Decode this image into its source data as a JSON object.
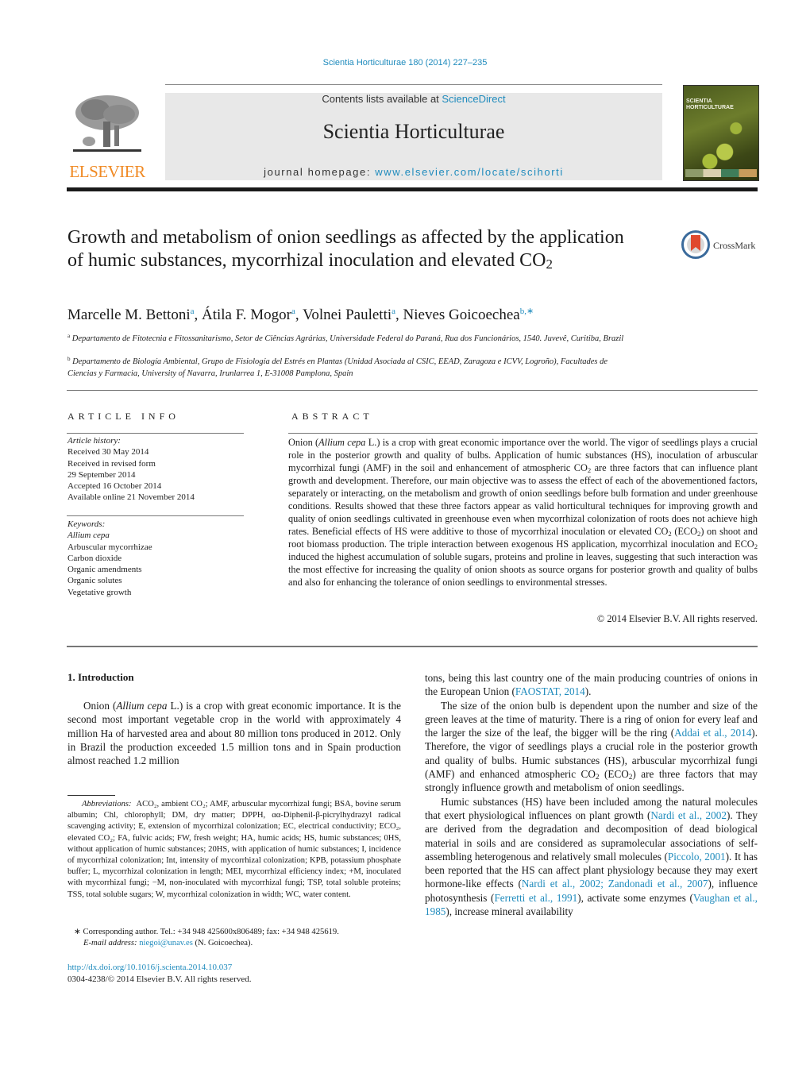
{
  "header": {
    "journal_citation": "Scientia Horticulturae 180 (2014) 227–235",
    "contents_prefix": "Contents lists available at ",
    "contents_link": "ScienceDirect",
    "journal_title": "Scientia Horticulturae",
    "homepage_prefix": "journal homepage: ",
    "homepage_link": "www.elsevier.com/locate/scihorti",
    "publisher_logo_text": "ELSEVIER",
    "cover_title_line1": "SCIENTIA",
    "cover_title_line2": "HORTICULTURAE",
    "brand_color": "#f08a24",
    "link_color": "#1f8bbd"
  },
  "article": {
    "title_part1": "Growth and metabolism of onion seedlings as affected by the application of humic substances, mycorrhizal inoculation and elevated CO",
    "title_sub": "2",
    "crossmark_label": "CrossMark",
    "authors": [
      {
        "name": "Marcelle M. Bettoni",
        "sup": "a"
      },
      {
        "name": "Átila F. Mogor",
        "sup": "a"
      },
      {
        "name": "Volnei Pauletti",
        "sup": "a"
      },
      {
        "name": "Nieves Goicoechea",
        "sup": "b,∗"
      }
    ],
    "affiliations": [
      {
        "mark": "a",
        "text": "Departamento de Fitotecnia e Fitossanitarismo, Setor de Ciências Agrárias, Universidade Federal do Paraná, Rua dos Funcionários, 1540. Juvevê, Curitiba, Brazil"
      },
      {
        "mark": "b",
        "text": "Departamento de Biología Ambiental, Grupo de Fisiología del Estrés en Plantas (Unidad Asociada al CSIC, EEAD, Zaragoza e ICVV, Logroño), Facultades de Ciencias y Farmacia, University of Navarra, Irunlarrea 1, E-31008 Pamplona, Spain"
      }
    ]
  },
  "article_info": {
    "heading": "ARTICLE INFO",
    "history_label": "Article history:",
    "history": [
      "Received 30 May 2014",
      "Received in revised form",
      "29 September 2014",
      "Accepted 16 October 2014",
      "Available online 21 November 2014"
    ],
    "keywords_label": "Keywords:",
    "keywords": [
      "Allium cepa",
      "Arbuscular mycorrhizae",
      "Carbon dioxide",
      "Organic amendments",
      "Organic solutes",
      "Vegetative growth"
    ]
  },
  "abstract": {
    "heading": "ABSTRACT",
    "t1": "Onion (",
    "t1_italic": "Allium cepa",
    "t2": " L.) is a crop with great economic importance over the world. The vigor of seedlings plays a crucial role in the posterior growth and quality of bulbs. Application of humic substances (HS), inoculation of arbuscular mycorrhizal fungi (AMF) in the soil and enhancement of atmospheric CO",
    "t3": " are three factors that can influence plant growth and development. Therefore, our main objective was to assess the effect of each of the abovementioned factors, separately or interacting, on the metabolism and growth of onion seedlings before bulb formation and under greenhouse conditions. Results showed that these three factors appear as valid horticultural techniques for improving growth and quality of onion seedlings cultivated in greenhouse even when mycorrhizal colonization of roots does not achieve high rates. Beneficial effects of HS were additive to those of mycorrhizal inoculation or elevated CO",
    "t4": " (ECO",
    "t5": ") on shoot and root biomass production. The triple interaction between exogenous HS application, mycorrhizal inoculation and ECO",
    "t6": " induced the highest accumulation of soluble sugars, proteins and proline in leaves, suggesting that such interaction was the most effective for increasing the quality of onion shoots as source organs for posterior growth and quality of bulbs and also for enhancing the tolerance of onion seedlings to environmental stresses.",
    "sub": "2",
    "copyright": "© 2014 Elsevier B.V. All rights reserved."
  },
  "introduction": {
    "heading": "1.  Introduction",
    "p1_a": "Onion (",
    "p1_italic": "Allium cepa",
    "p1_b": " L.) is a crop with great economic importance. It is the second most important vegetable crop in the world with approximately 4 million Ha of harvested area and about 80 million tons produced in 2012. Only in Brazil the production exceeded 1.5 million tons and in Spain production almost reached 1.2 million",
    "p1_cont": "tons, being this last country one of the main producing countries of onions in the European Union (",
    "p1_ref": "FAOSTAT, 2014",
    "p1_end": ").",
    "p2_a": "The size of the onion bulb is dependent upon the number and size of the green leaves at the time of maturity. There is a ring of onion for every leaf and the larger the size of the leaf, the bigger will be the ring (",
    "p2_ref": "Addai et al., 2014",
    "p2_b": "). Therefore, the vigor of seedlings plays a crucial role in the posterior growth and quality of bulbs. Humic substances (HS), arbuscular mycorrhizal fungi (AMF) and enhanced atmospheric CO",
    "p2_c": " (ECO",
    "p2_d": ") are three factors that may strongly influence growth and metabolism of onion seedlings.",
    "p3_a": "Humic substances (HS) have been included among the natural molecules that exert physiological influences on plant growth (",
    "p3_ref1": "Nardi et al., 2002",
    "p3_b": "). They are derived from the degradation and decomposition of dead biological material in soils and are considered as supramolecular associations of self-assembling heterogenous and relatively small molecules (",
    "p3_ref2": "Piccolo, 2001",
    "p3_c": "). It has been reported that the HS can affect plant physiology because they may exert hormone-like effects (",
    "p3_ref3": "Nardi et al., 2002; Zandonadi et al., 2007",
    "p3_d": "), influence photosynthesis (",
    "p3_ref4": "Ferretti et al., 1991",
    "p3_e": "), activate some enzymes (",
    "p3_ref5": "Vaughan et al., 1985",
    "p3_f": "), increase mineral availability",
    "sub": "2"
  },
  "footnotes": {
    "abbrev_label": "Abbreviations:",
    "abbrev_text": "ACO₂, ambient CO₂; AMF, arbuscular mycorrhizal fungi; BSA, bovine serum albumin; Chl, chlorophyll; DM, dry matter; DPPH, αα-Diphenil-β-picrylhydrazyl radical scavenging activity; E, extension of mycorrhizal colonization; EC, electrical conductivity; ECO₂, elevated CO₂; FA, fulvic acids; FW, fresh weight; HA, humic acids; HS, humic substances; 0HS, without application of humic substances; 20HS, with application of humic substances; I, incidence of mycorrhizal colonization; Int, intensity of mycorrhizal colonization; KPB, potassium phosphate buffer; L, mycorrhizal colonization in length; MEI, mycorrhizal efficiency index; +M, inoculated with mycorrhizal fungi; −M, non-inoculated with mycorrhizal fungi; TSP, total soluble proteins; TSS, total soluble sugars; W, mycorrhizal colonization in width; WC, water content.",
    "corresponding": "∗  Corresponding author. Tel.: +34 948 425600x806489; fax: +34 948 425619.",
    "email_label": "E-mail address: ",
    "email": "niegoi@unav.es",
    "email_suffix": " (N. Goicoechea).",
    "doi": "http://dx.doi.org/10.1016/j.scienta.2014.10.037",
    "issn_line": "0304-4238/© 2014 Elsevier B.V. All rights reserved."
  }
}
